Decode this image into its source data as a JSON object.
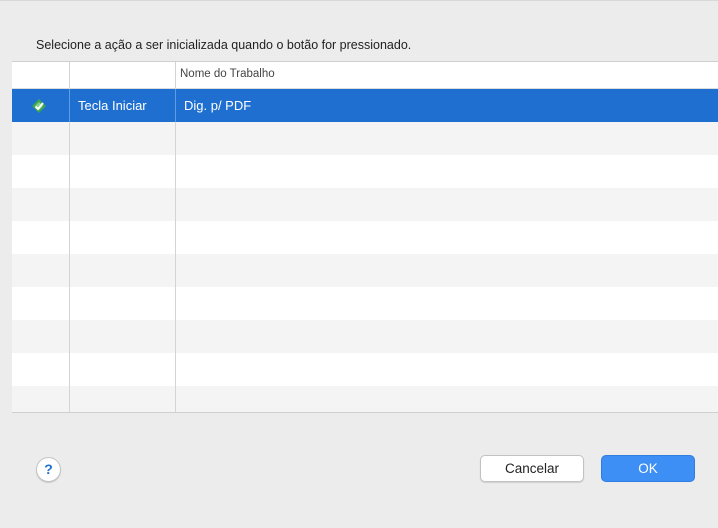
{
  "dialog": {
    "prompt": "Selecione a ação a ser inicializada quando o botão for pressionado."
  },
  "table": {
    "columns": [
      "",
      "",
      "Nome do Trabalho"
    ],
    "rows": [
      {
        "button": "Tecla Iniciar",
        "job": "Dig. p/ PDF",
        "icon": "scan-to-pdf-icon",
        "selected": true
      }
    ]
  },
  "footer": {
    "help": "?",
    "cancel": "Cancelar",
    "ok": "OK"
  },
  "colors": {
    "selection": "#1f6fd1",
    "ok_button": "#3d8ff5",
    "icon_green": "#3aa64f"
  }
}
